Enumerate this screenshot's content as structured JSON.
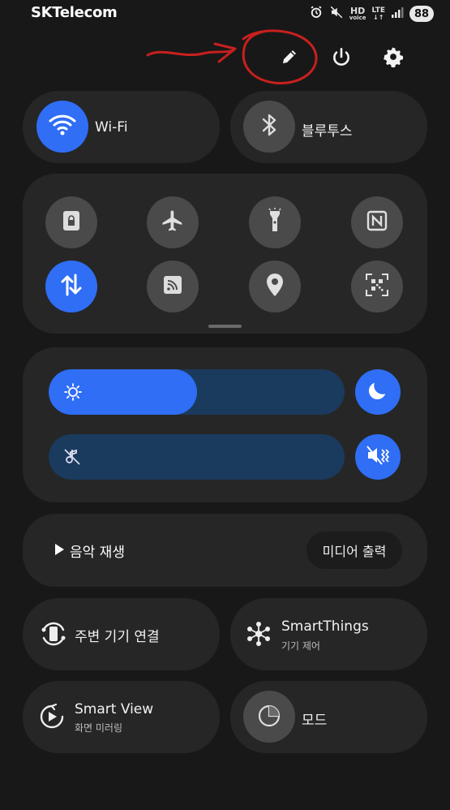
{
  "status_bar": {
    "carrier": "SKTelecom",
    "net_top": "HD",
    "net_bottom": "voice",
    "lte_top": "LTE",
    "lte_bottom": "↓↑",
    "battery": "88",
    "icons": [
      "alarm-icon",
      "mute-icon",
      "hd-voice-icon",
      "lte-icon",
      "signal-icon",
      "battery-icon"
    ]
  },
  "toolbar": {
    "icons": [
      "edit-pencil-icon",
      "power-icon",
      "settings-gear-icon"
    ],
    "annotation": "red hand-drawn arrow and circle around edit icon"
  },
  "big_tiles": [
    {
      "label": "Wi-Fi",
      "icon": "wifi-icon",
      "active": true
    },
    {
      "label": "블루투스",
      "icon": "bluetooth-icon",
      "active": false
    }
  ],
  "quick_tiles": [
    {
      "icon": "secure-folder-icon",
      "active": false
    },
    {
      "icon": "airplane-icon",
      "active": false
    },
    {
      "icon": "flashlight-icon",
      "active": false
    },
    {
      "icon": "nfc-icon",
      "active": false
    },
    {
      "icon": "mobile-data-icon",
      "active": true
    },
    {
      "icon": "cast-icon",
      "active": false
    },
    {
      "icon": "location-icon",
      "active": false
    },
    {
      "icon": "qr-scan-icon",
      "active": false
    }
  ],
  "sliders": {
    "brightness": {
      "value": 0.5,
      "icon": "brightness-sun-icon"
    },
    "volume": {
      "value": 0,
      "icon": "volume-muted-note-icon"
    },
    "dark_mode_icon": "moon-icon",
    "sound_mode_icon": "mute-vibrate-icon"
  },
  "media": {
    "play_label": "음악 재생",
    "output_label": "미디어 출력"
  },
  "bottom_tiles": [
    {
      "label": "주변 기기 연결",
      "sub": "",
      "icon": "device-connect-icon"
    },
    {
      "label": "SmartThings",
      "sub": "기기 제어",
      "icon": "smartthings-icon"
    },
    {
      "label": "Smart View",
      "sub": "화면 미러링",
      "icon": "smart-view-icon"
    },
    {
      "label": "모드",
      "sub": "",
      "icon": "modes-icon"
    }
  ],
  "colors": {
    "accent": "#2f6ef5",
    "background": "#181818",
    "card": "#262626",
    "slider_track": "#1a3a5e"
  }
}
